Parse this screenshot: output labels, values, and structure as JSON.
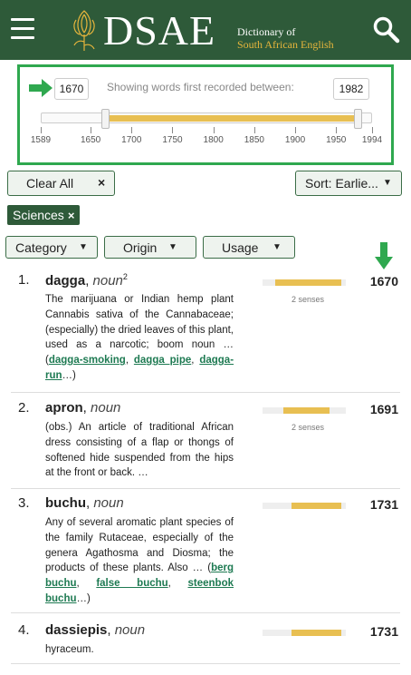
{
  "header": {
    "logo_text": "DSAE",
    "subtitle_line1": "Dictionary of",
    "subtitle_line2": "South African English",
    "menu_icon": "hamburger-icon",
    "search_icon": "search-icon",
    "colors": {
      "background": "#2e5a39",
      "accent": "#e6b53c"
    }
  },
  "date_range": {
    "from": "1670",
    "to": "1982",
    "label": "Showing words first recorded between:",
    "min": 1589,
    "max": 1994,
    "ticks": [
      "1589",
      "1650",
      "1700",
      "1750",
      "1800",
      "1850",
      "1900",
      "1950",
      "1994"
    ],
    "fill_color": "#e8bf52",
    "border_color": "#2fa84f"
  },
  "controls": {
    "clear_all": "Clear All",
    "clear_x": "×",
    "sort": "Sort: Earlie...",
    "active_tag": "Sciences",
    "tag_x": "×",
    "filters": [
      "Category",
      "Origin",
      "Usage"
    ],
    "caret": "▼"
  },
  "results": [
    {
      "num": "1.",
      "word": "dagga",
      "pos": "noun",
      "sup": "2",
      "def_text": "The marijuana or Indian hemp plant Cannabis sativa of the Cannabaceae; (especially) the dried leaves of this plant, used as a narcotic; boom noun …",
      "links": [
        "dagga-smoking",
        "dagga pipe",
        "dagga-run"
      ],
      "senses": "2 senses",
      "year": "1670",
      "bar_start": 0.15,
      "bar_end": 0.95
    },
    {
      "num": "2.",
      "word": "apron",
      "pos": "noun",
      "sup": "",
      "def_text": "(obs.) An article of traditional African dress consisting of a flap or thongs of softened hide suspended from the hips at the front or back. …",
      "links": [],
      "senses": "2 senses",
      "year": "1691",
      "bar_start": 0.25,
      "bar_end": 0.8
    },
    {
      "num": "3.",
      "word": "buchu",
      "pos": "noun",
      "sup": "",
      "def_text": "Any of several aromatic plant species of the family Rutaceae, especially of the genera Agathosma and Diosma; the products of these plants. Also …",
      "links": [
        "berg buchu",
        "false buchu",
        "steenbok buchu"
      ],
      "senses": "",
      "year": "1731",
      "bar_start": 0.35,
      "bar_end": 0.95
    },
    {
      "num": "4.",
      "word": "dassiepis",
      "pos": "noun",
      "sup": "",
      "def_text": "hyraceum.",
      "links": [],
      "senses": "",
      "year": "1731",
      "bar_start": 0.35,
      "bar_end": 0.95
    }
  ]
}
